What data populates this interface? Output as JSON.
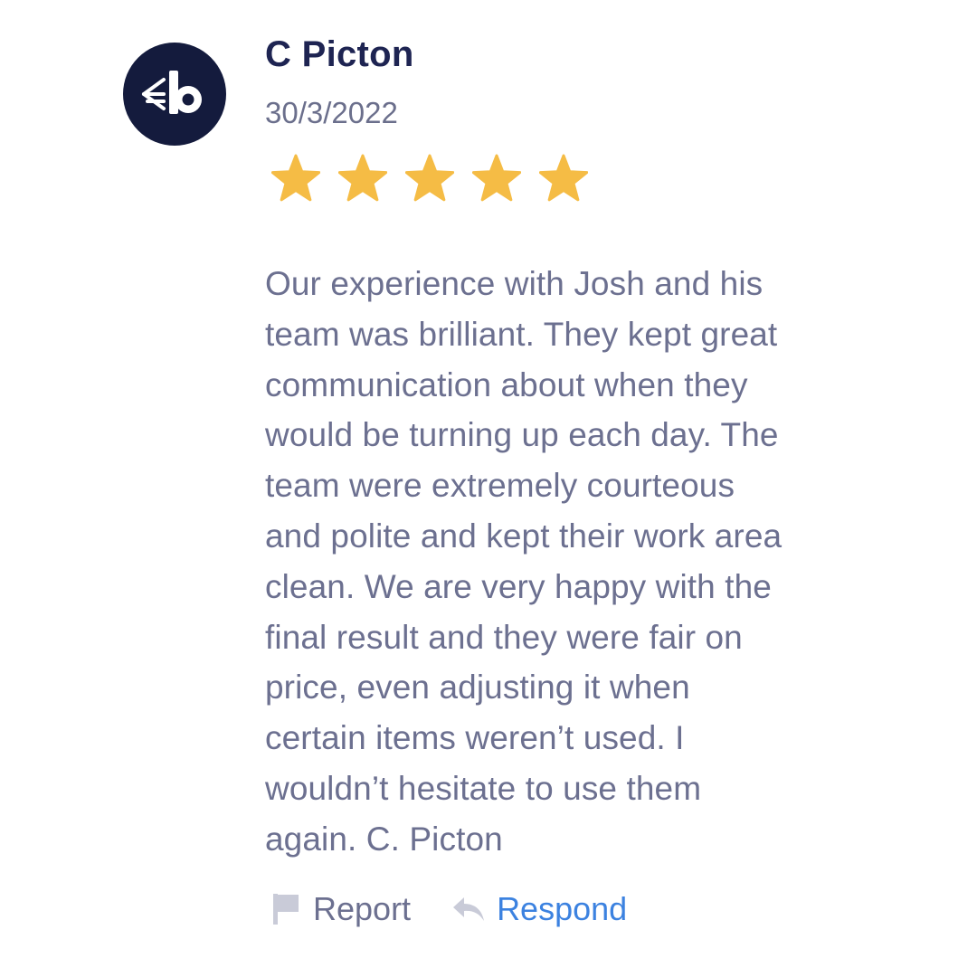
{
  "review": {
    "reviewer_name": "C Picton",
    "date": "30/3/2022",
    "rating": 5,
    "rating_max": 5,
    "body": "Our experience with Josh and his\nteam was brilliant. They kept great\ncommunication about when they\nwould be turning up each day. The\nteam were extremely courteous\nand polite and kept their work area\nclean. We are very happy with the\nfinal result and they were fair on\nprice, even adjusting it when\ncertain items weren’t used. I\nwouldn’t hesitate to use them\nagain. C. Picton"
  },
  "actions": {
    "report_label": "Report",
    "report_icon": "flag-icon",
    "respond_label": "Respond",
    "respond_icon": "reply-arrow-icon"
  },
  "colors": {
    "avatar_bg": "#141b3d",
    "star": "#f5bc45",
    "name": "#1e2452",
    "body_text": "#6c7090",
    "respond_link": "#3c82e0"
  }
}
